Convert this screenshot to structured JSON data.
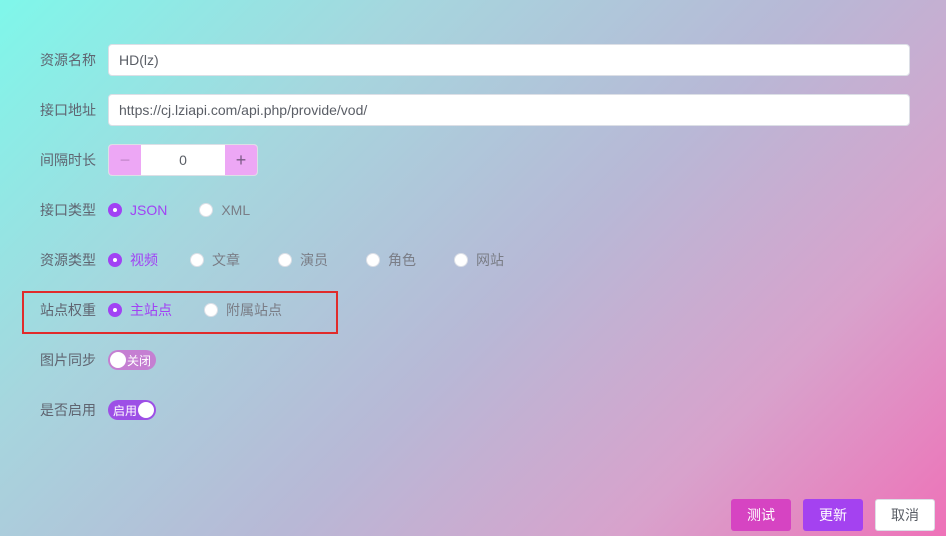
{
  "form": {
    "resource_name": {
      "label": "资源名称",
      "value": "HD(lz)"
    },
    "api_url": {
      "label": "接口地址",
      "value": "https://cj.lziapi.com/api.php/provide/vod/"
    },
    "interval": {
      "label": "间隔时长",
      "value": "0",
      "minus": "−",
      "plus": "+"
    },
    "api_type": {
      "label": "接口类型",
      "options": [
        {
          "label": "JSON",
          "checked": true
        },
        {
          "label": "XML",
          "checked": false
        }
      ]
    },
    "resource_type": {
      "label": "资源类型",
      "options": [
        {
          "label": "视频",
          "checked": true
        },
        {
          "label": "文章",
          "checked": false
        },
        {
          "label": "演员",
          "checked": false
        },
        {
          "label": "角色",
          "checked": false
        },
        {
          "label": "网站",
          "checked": false
        }
      ]
    },
    "site_weight": {
      "label": "站点权重",
      "options": [
        {
          "label": "主站点",
          "checked": true
        },
        {
          "label": "附属站点",
          "checked": false
        }
      ]
    },
    "image_sync": {
      "label": "图片同步",
      "switch_text": "关闭",
      "state": "off"
    },
    "enabled": {
      "label": "是否启用",
      "switch_text": "启用",
      "state": "on"
    }
  },
  "footer": {
    "test_label": "测试",
    "update_label": "更新",
    "cancel_label": "取消"
  },
  "colors": {
    "accent": "#a142f4",
    "test_button": "#d644c2",
    "highlight_border": "#e02b2b"
  }
}
